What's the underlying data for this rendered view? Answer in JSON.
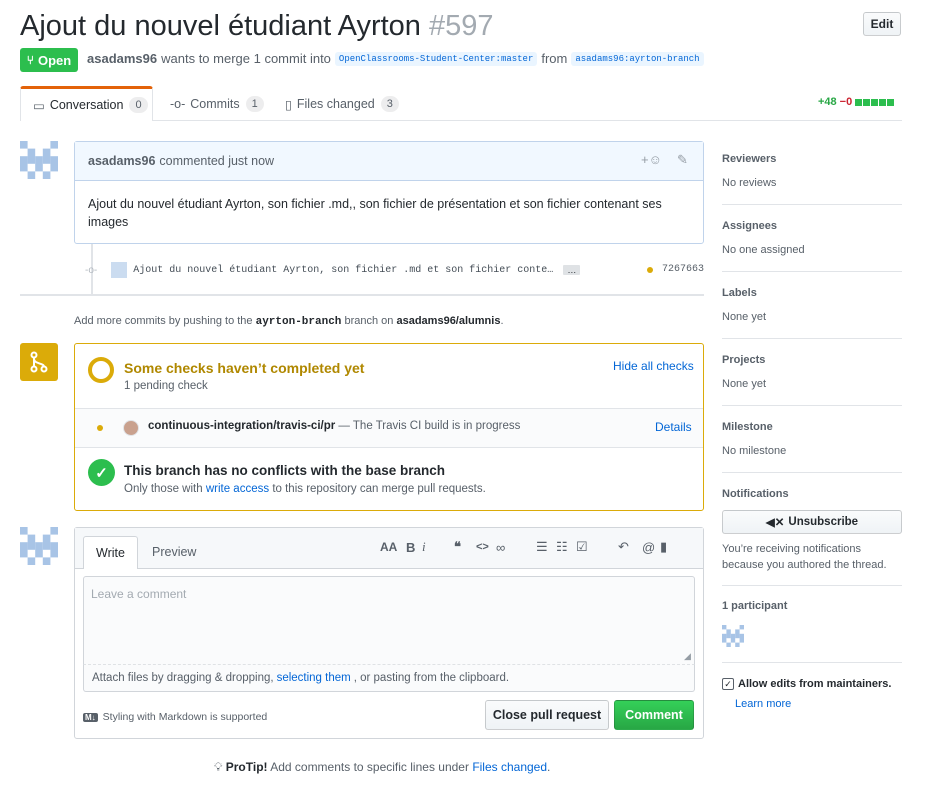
{
  "header": {
    "title": "Ajout du nouvel étudiant Ayrton",
    "number": "#597",
    "edit_label": "Edit",
    "state_label": "Open",
    "author": "asadams96",
    "merge_text": "wants to merge 1 commit into",
    "base_branch": "OpenClassrooms-Student-Center:master",
    "from_text": "from",
    "head_branch": "asadams96:ayrton-branch"
  },
  "tabs": [
    {
      "label": "Conversation",
      "count": "0"
    },
    {
      "label": "Commits",
      "count": "1"
    },
    {
      "label": "Files changed",
      "count": "3"
    }
  ],
  "diffstat": {
    "additions": "+48",
    "deletions": "−0"
  },
  "comment": {
    "author": "asadams96",
    "action": "commented just now",
    "body": "Ajout du nouvel étudiant Ayrton, son fichier .md,, son fichier de présentation et son fichier contenant ses images"
  },
  "commit": {
    "message": "Ajout du nouvel étudiant Ayrton, son fichier .md et son fichier conte…",
    "ellipsis": "…",
    "sha": "7267663"
  },
  "push_hint": {
    "prefix": "Add more commits by pushing to the",
    "branch": "ayrton-branch",
    "middle": "branch on",
    "repo": "asadams96/alumnis",
    "suffix": "."
  },
  "checks": {
    "title": "Some checks haven’t completed yet",
    "subtitle": "1 pending check",
    "hide_label": "Hide all checks",
    "item_name": "continuous-integration/travis-ci/pr",
    "item_desc": "— The Travis CI build is in progress",
    "details_label": "Details",
    "merge_title": "This branch has no conflicts with the base branch",
    "merge_prefix": "Only those with",
    "merge_link": "write access",
    "merge_suffix": "to this repository can merge pull requests."
  },
  "composer": {
    "tab_write": "Write",
    "tab_preview": "Preview",
    "placeholder": "Leave a comment",
    "attach_prefix": "Attach files by dragging & dropping,",
    "attach_link": "selecting them",
    "attach_suffix": ", or pasting from the clipboard.",
    "markdown_note": "Styling with Markdown is supported",
    "close_label": "Close pull request",
    "comment_label": "Comment",
    "toolbar_aa": "AA",
    "toolbar_b": "B",
    "toolbar_i": "i",
    "toolbar_quote": "❝",
    "toolbar_code": "<>",
    "toolbar_at": "@"
  },
  "protip": {
    "bold": "ProTip!",
    "text": "Add comments to specific lines under",
    "link": "Files changed",
    "suffix": "."
  },
  "sidebar": {
    "reviewers_h": "Reviewers",
    "reviewers_v": "No reviews",
    "assignees_h": "Assignees",
    "assignees_v": "No one assigned",
    "labels_h": "Labels",
    "labels_v": "None yet",
    "projects_h": "Projects",
    "projects_v": "None yet",
    "milestone_h": "Milestone",
    "milestone_v": "No milestone",
    "notifications_h": "Notifications",
    "unsubscribe_label": "Unsubscribe",
    "notif_reason": "You’re receiving notifications because you authored the thread.",
    "participants_h": "1 participant",
    "allow_edits": "Allow edits from maintainers.",
    "learn_more": "Learn more"
  },
  "colors": {
    "green": "#2cbe4e",
    "yellow": "#dbab09",
    "blue": "#0366d6",
    "red": "#cb2431"
  }
}
